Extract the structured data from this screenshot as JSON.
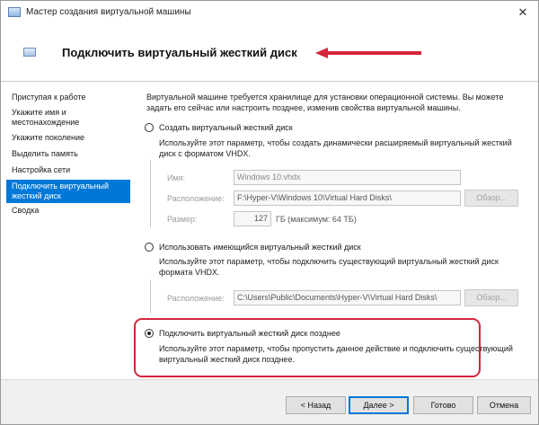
{
  "window": {
    "title": "Мастер создания виртуальной машины",
    "close_glyph": "✕"
  },
  "header": {
    "title": "Подключить виртуальный жесткий диск"
  },
  "sidebar": {
    "items": [
      {
        "label": "Приступая к работе"
      },
      {
        "label": "Укажите имя и местонахождение"
      },
      {
        "label": "Укажите поколение"
      },
      {
        "label": "Выделить память"
      },
      {
        "label": "Настройка сети"
      },
      {
        "label": "Подключить виртуальный жесткий диск",
        "active": true
      },
      {
        "label": "Сводка"
      }
    ]
  },
  "main": {
    "intro": "Виртуальной машине требуется хранилище для установки операционной системы. Вы можете задать его сейчас или настроить позднее, изменив свойства виртуальной машины.",
    "option_create": {
      "label": "Создать виртуальный жесткий диск",
      "description": "Используйте этот параметр, чтобы создать динамически расширяемый виртуальный жесткий диск с форматом VHDX.",
      "name_label": "Имя:",
      "name_value": "Windows 10.vhdx",
      "location_label": "Расположение:",
      "location_value": "F:\\Hyper-V\\Windows 10\\Virtual Hard Disks\\",
      "browse_label": "Обзор...",
      "size_label": "Размер:",
      "size_value": "127",
      "size_unit": "ГБ (максимум: 64 ТБ)"
    },
    "option_existing": {
      "label": "Использовать имеющийся виртуальный жесткий диск",
      "description": "Используйте этот параметр, чтобы подключить существующий виртуальный жесткий диск формата VHDX.",
      "location_label": "Расположение:",
      "location_value": "C:\\Users\\Public\\Documents\\Hyper-V\\Virtual Hard Disks\\",
      "browse_label": "Обзор..."
    },
    "option_later": {
      "label": "Подключить виртуальный жесткий диск позднее",
      "description": "Используйте этот параметр, чтобы пропустить данное действие и подключить существующий виртуальный жесткий диск позднее.",
      "selected": true
    }
  },
  "footer": {
    "back_label": "< Назад",
    "next_label": "Далее >",
    "finish_label": "Готово",
    "cancel_label": "Отмена"
  },
  "colors": {
    "accent": "#0078d7",
    "annotation_red": "#d6253a"
  }
}
